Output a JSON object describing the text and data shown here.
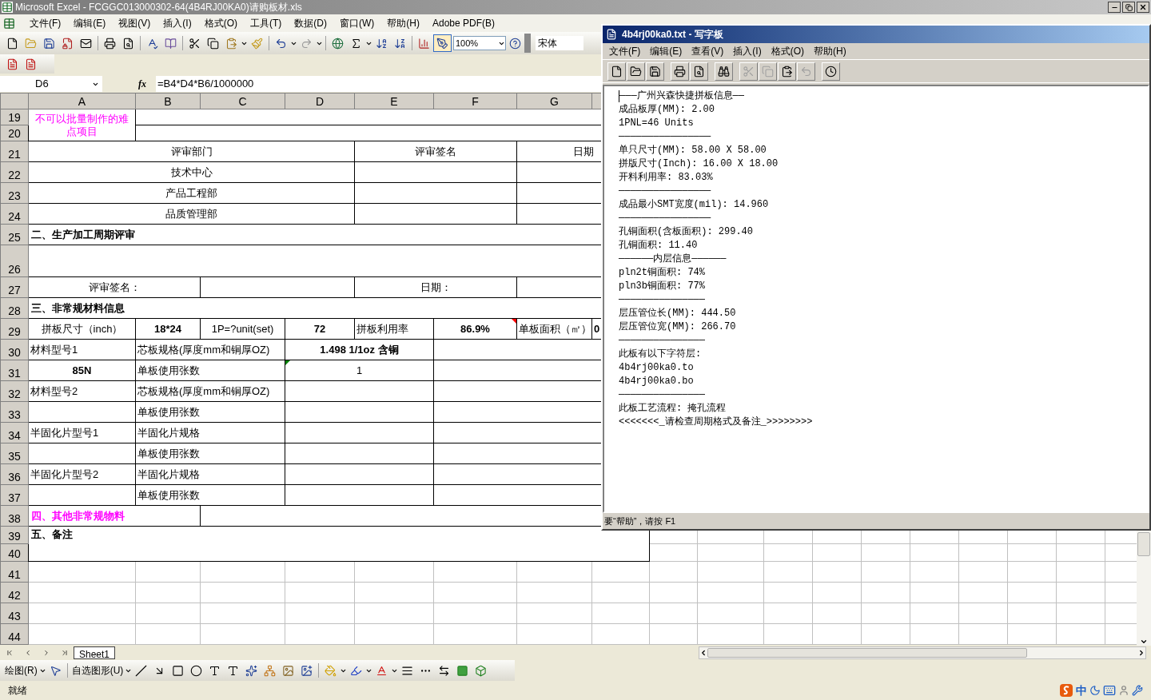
{
  "excel": {
    "title": "Microsoft Excel - FCGGC013000302-64(4B4RJ00KA0)请购板材.xls",
    "menus": [
      "文件(F)",
      "编辑(E)",
      "视图(V)",
      "插入(I)",
      "格式(O)",
      "工具(T)",
      "数据(D)",
      "窗口(W)",
      "帮助(H)",
      "Adobe PDF(B)"
    ],
    "toolbar": {
      "zoom": "100%",
      "font": "宋体",
      "drawing_on": true
    },
    "formula_bar": {
      "name_box": "D6",
      "function_label": "fx",
      "formula": "=B4*D4*B6/1000000"
    },
    "columns": [
      "A",
      "B",
      "C",
      "D",
      "E",
      "F",
      "G"
    ],
    "rows": [
      {
        "number": "19",
        "cells": [
          {
            "kind": "note",
            "text": "不可以批量制作的难点项目"
          },
          {
            "kind": "empty"
          }
        ]
      },
      {
        "number": "20",
        "cells": [
          {
            "kind": "empty"
          }
        ]
      },
      {
        "number": "21",
        "cells": [
          {
            "kind": "center",
            "text": "评审部门"
          },
          {
            "kind": "center",
            "text": "评审签名"
          },
          {
            "kind": "center",
            "text": "日期"
          }
        ]
      },
      {
        "number": "22",
        "cells": [
          {
            "kind": "center",
            "text": "技术中心"
          },
          {
            "kind": "empty"
          },
          {
            "kind": "empty"
          }
        ]
      },
      {
        "number": "23",
        "cells": [
          {
            "kind": "center",
            "text": "产品工程部"
          },
          {
            "kind": "empty"
          },
          {
            "kind": "empty"
          }
        ]
      },
      {
        "number": "24",
        "cells": [
          {
            "kind": "center",
            "text": "品质管理部"
          },
          {
            "kind": "empty"
          },
          {
            "kind": "empty"
          }
        ]
      },
      {
        "number": "25",
        "cells": [
          {
            "kind": "section",
            "text": "二、生产加工周期评审"
          }
        ]
      },
      {
        "number": "26",
        "cells": [
          {
            "kind": "empty"
          }
        ]
      },
      {
        "number": "27",
        "cells": [
          {
            "kind": "center",
            "text": "评审签名："
          },
          {
            "kind": "empty"
          },
          {
            "kind": "center",
            "text": "日期："
          },
          {
            "kind": "empty"
          }
        ]
      },
      {
        "number": "28",
        "cells": [
          {
            "kind": "section",
            "text": "三、非常规材料信息"
          }
        ]
      },
      {
        "number": "29",
        "cells": [
          {
            "kind": "center",
            "text": "拼板尺寸（inch）"
          },
          {
            "kind": "value",
            "text": "18*24"
          },
          {
            "kind": "center",
            "text": "1P=?unit(set)"
          },
          {
            "kind": "value",
            "text": "72"
          },
          {
            "kind": "label",
            "text": "拼板利用率"
          },
          {
            "kind": "value",
            "text": "86.9%",
            "comment": true
          },
          {
            "kind": "label",
            "text": "单板面积（㎡）"
          },
          {
            "kind": "figure",
            "text": "0"
          }
        ]
      },
      {
        "number": "30",
        "cells": [
          {
            "kind": "label",
            "text": "材料型号1"
          },
          {
            "kind": "label",
            "text": "芯板规格(厚度mm和铜厚OZ)"
          },
          {
            "kind": "value",
            "text": "1.498 1/1oz 含铜"
          },
          {
            "kind": "empty"
          }
        ]
      },
      {
        "number": "31",
        "cells": [
          {
            "kind": "value",
            "text": "85N"
          },
          {
            "kind": "label",
            "text": "单板使用张数"
          },
          {
            "kind": "center",
            "text": "1",
            "error_flag": true
          },
          {
            "kind": "empty"
          }
        ]
      },
      {
        "number": "32",
        "cells": [
          {
            "kind": "label",
            "text": "材料型号2"
          },
          {
            "kind": "label",
            "text": "芯板规格(厚度mm和铜厚OZ)"
          },
          {
            "kind": "empty"
          },
          {
            "kind": "empty"
          }
        ]
      },
      {
        "number": "33",
        "cells": [
          {
            "kind": "empty"
          },
          {
            "kind": "label",
            "text": "单板使用张数"
          },
          {
            "kind": "empty"
          },
          {
            "kind": "empty"
          }
        ]
      },
      {
        "number": "34",
        "cells": [
          {
            "kind": "label",
            "text": "半固化片型号1"
          },
          {
            "kind": "label",
            "text": "半固化片规格"
          },
          {
            "kind": "empty"
          },
          {
            "kind": "empty"
          }
        ]
      },
      {
        "number": "35",
        "cells": [
          {
            "kind": "empty"
          },
          {
            "kind": "label",
            "text": "单板使用张数"
          },
          {
            "kind": "empty"
          },
          {
            "kind": "empty"
          }
        ]
      },
      {
        "number": "36",
        "cells": [
          {
            "kind": "label",
            "text": "半固化片型号2"
          },
          {
            "kind": "label",
            "text": "半固化片规格"
          },
          {
            "kind": "empty"
          },
          {
            "kind": "empty"
          }
        ]
      },
      {
        "number": "37",
        "cells": [
          {
            "kind": "empty"
          },
          {
            "kind": "label",
            "text": "单板使用张数"
          },
          {
            "kind": "empty"
          },
          {
            "kind": "empty"
          }
        ]
      },
      {
        "number": "38",
        "cells": [
          {
            "kind": "alert",
            "text": "四、其他非常规物料"
          },
          {
            "kind": "empty"
          }
        ]
      },
      {
        "number": "39",
        "cells": [
          {
            "kind": "section",
            "text": "五、备注"
          }
        ]
      },
      {
        "number": "40"
      },
      {
        "number": "41"
      },
      {
        "number": "42"
      },
      {
        "number": "43"
      },
      {
        "number": "44"
      }
    ],
    "sheet_tabs": [
      {
        "label": "Sheet1",
        "selected": true
      }
    ],
    "drawing_toolbar": {
      "draw_menu": "绘图(R)",
      "autoshapes_menu": "自选图形(U)"
    },
    "status_bar": {
      "text": "就绪",
      "ime_mode": "中"
    }
  },
  "wordpad": {
    "title": "4b4rj00ka0.txt - 写字板",
    "menus": [
      "文件(F)",
      "编辑(E)",
      "查看(V)",
      "插入(I)",
      "格式(O)",
      "帮助(H)"
    ],
    "toolbar": [
      {
        "kind": "new",
        "disabled": false
      },
      {
        "kind": "open",
        "disabled": false
      },
      {
        "kind": "save",
        "disabled": false
      },
      {
        "kind": "print",
        "disabled": false
      },
      {
        "kind": "preview",
        "disabled": false
      },
      {
        "kind": "find",
        "disabled": false
      },
      {
        "kind": "cut",
        "disabled": true
      },
      {
        "kind": "copy",
        "disabled": true
      },
      {
        "kind": "paste",
        "disabled": false
      },
      {
        "kind": "undo",
        "disabled": true
      },
      {
        "kind": "datetime",
        "disabled": false
      }
    ],
    "lines": [
      "———广州兴森快捷拼板信息——",
      "成品板厚(MM): 2.00",
      "1PNL=46 Units",
      "————————————————",
      "单只尺寸(MM): 58.00 X 58.00",
      "拼版尺寸(Inch): 16.00 X 18.00",
      "开料利用率: 83.03%",
      "————————————————",
      "成品最小SMT宽度(mil): 14.960",
      "————————————————",
      "孔铜面积(含板面积): 299.40",
      "孔铜面积: 11.40",
      "——————内层信息——————",
      "pln2t铜面积: 74%",
      "pln3b铜面积: 77%",
      "———————————————",
      "层压管位长(MM): 444.50",
      "层压管位宽(MM): 266.70",
      "———————————————",
      "此板有以下字符层:",
      "4b4rj00ka0.to",
      "4b4rj00ka0.bo",
      "———————————————",
      "此板工艺流程: 掩孔流程",
      "<<<<<<<_请检查周期格式及备注_>>>>>>>>"
    ],
    "status_bar": "要“帮助”，请按 F1"
  }
}
